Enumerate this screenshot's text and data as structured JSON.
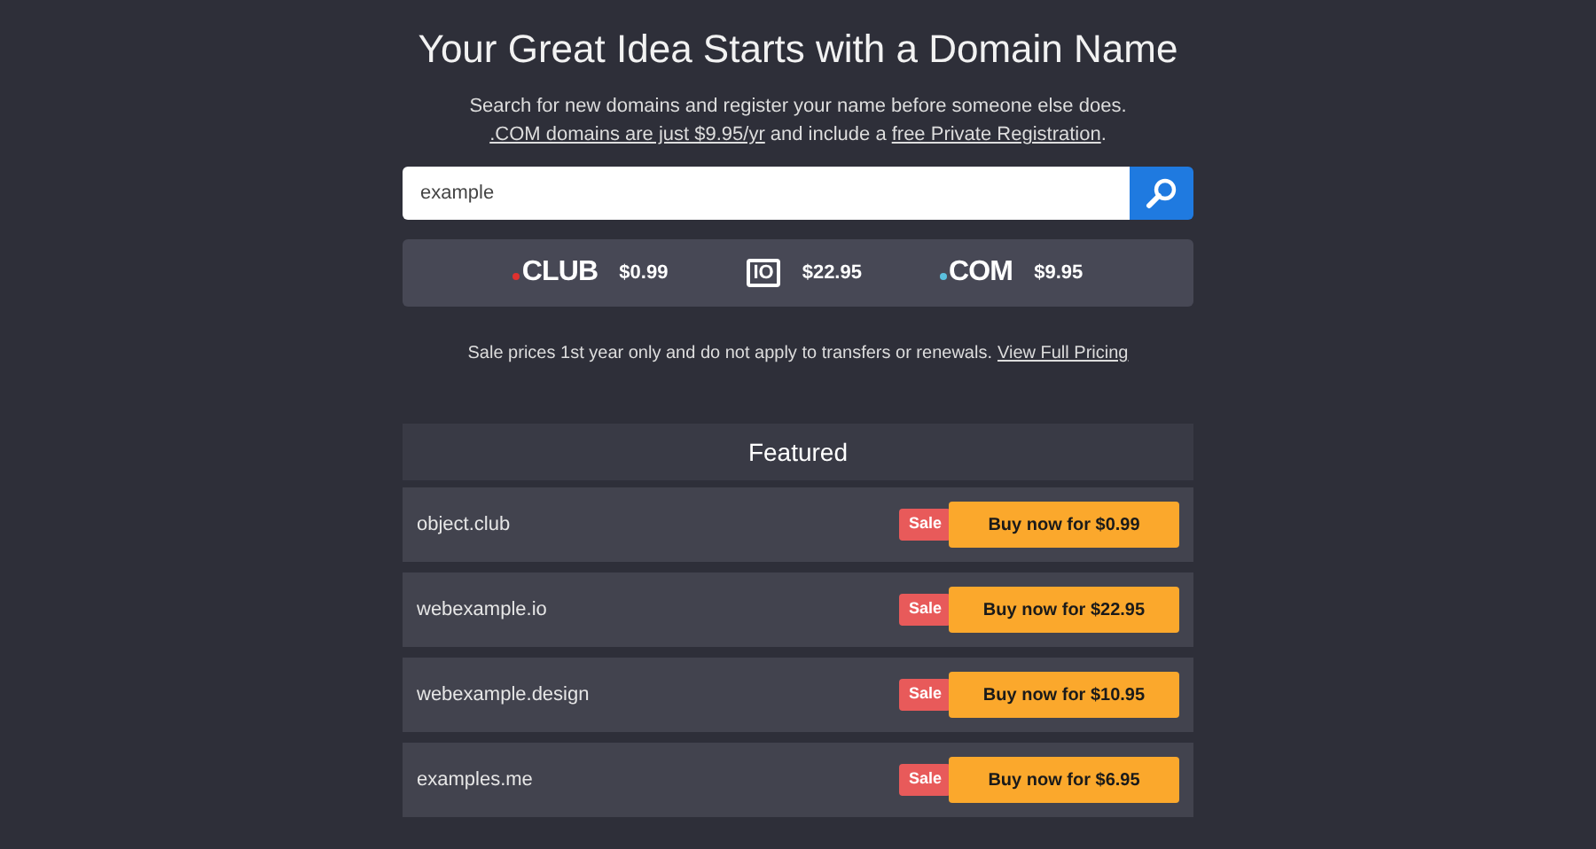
{
  "title": "Your Great Idea Starts with a Domain Name",
  "subtitle": "Search for new domains and register your name before someone else does.",
  "offer": {
    "link1": ".COM domains are just $9.95/yr",
    "middle": "and include a",
    "link2": "free Private Registration",
    "end": "."
  },
  "search": {
    "value": "example"
  },
  "promos": [
    {
      "logo": "CLUB",
      "kind": "dot",
      "color": "#e0312f",
      "price": "$0.99"
    },
    {
      "logo": "IO",
      "kind": "boxed",
      "price": "$22.95"
    },
    {
      "logo": "COM",
      "kind": "dot",
      "color": "#5bc0de",
      "price": "$9.95"
    }
  ],
  "note": "Sale prices 1st year only and do not apply to transfers or renewals.",
  "note_link": "View Full Pricing",
  "featured": {
    "heading": "Featured",
    "rows": [
      {
        "domain": "object.club",
        "badge": "Sale",
        "button": "Buy now for $0.99"
      },
      {
        "domain": "webexample.io",
        "badge": "Sale",
        "button": "Buy now for $22.95"
      },
      {
        "domain": "webexample.design",
        "badge": "Sale",
        "button": "Buy now for $10.95"
      },
      {
        "domain": "examples.me",
        "badge": "Sale",
        "button": "Buy now for $6.95"
      }
    ]
  }
}
